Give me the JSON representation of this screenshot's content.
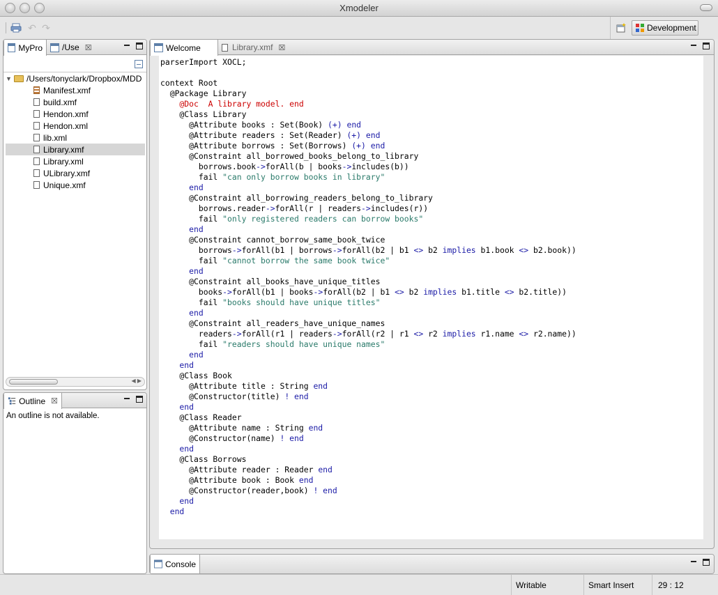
{
  "window": {
    "title": "Xmodeler"
  },
  "toolbar": {
    "print_icon": "print-icon",
    "back_icon": "back-arrow-icon",
    "forward_icon": "forward-arrow-icon",
    "perspective_label": "Development"
  },
  "explorer": {
    "tabs": [
      {
        "label": "MyPro",
        "icon": "package-explorer-icon"
      },
      {
        "label": "/Use",
        "icon": "navigator-icon",
        "closable": true
      }
    ],
    "tree": {
      "root": "/Users/tonyclark/Dropbox/MDD",
      "items": [
        {
          "label": "Manifest.xmf",
          "icon": "manifest-icon",
          "selected": false
        },
        {
          "label": "build.xmf",
          "icon": "file-icon",
          "selected": false
        },
        {
          "label": "Hendon.xmf",
          "icon": "file-icon",
          "selected": false
        },
        {
          "label": "Hendon.xml",
          "icon": "file-icon",
          "selected": false
        },
        {
          "label": "lib.xml",
          "icon": "file-icon",
          "selected": false
        },
        {
          "label": "Library.xmf",
          "icon": "file-icon",
          "selected": true
        },
        {
          "label": "Library.xml",
          "icon": "file-icon",
          "selected": false
        },
        {
          "label": "ULibrary.xmf",
          "icon": "file-icon",
          "selected": false
        },
        {
          "label": "Unique.xmf",
          "icon": "file-icon",
          "selected": false
        }
      ]
    }
  },
  "outline": {
    "tab_label": "Outline",
    "message": "An outline is not available."
  },
  "editor": {
    "tabs": [
      {
        "label": "Welcome",
        "active": true
      },
      {
        "label": "Library.xmf",
        "active": false,
        "closable": true
      }
    ],
    "lines": [
      [
        [
          "p",
          "parserImport XOCL;"
        ]
      ],
      [
        [
          "p",
          ""
        ]
      ],
      [
        [
          "p",
          "context Root"
        ]
      ],
      [
        [
          "p",
          "  @Package Library"
        ]
      ],
      [
        [
          "d",
          "    @Doc  A library model. end"
        ]
      ],
      [
        [
          "p",
          "    @Class Library"
        ]
      ],
      [
        [
          "p",
          "      @Attribute books : Set(Book) "
        ],
        [
          "k",
          "(+) end"
        ]
      ],
      [
        [
          "p",
          "      @Attribute readers : Set(Reader) "
        ],
        [
          "k",
          "(+) end"
        ]
      ],
      [
        [
          "p",
          "      @Attribute borrows : Set(Borrows) "
        ],
        [
          "k",
          "(+) end"
        ]
      ],
      [
        [
          "p",
          "      @Constraint all_borrowed_books_belong_to_library"
        ]
      ],
      [
        [
          "p",
          "        borrows.book"
        ],
        [
          "k",
          "->"
        ],
        [
          "p",
          "forAll(b | books"
        ],
        [
          "k",
          "->"
        ],
        [
          "p",
          "includes(b))"
        ]
      ],
      [
        [
          "p",
          "        fail "
        ],
        [
          "s",
          "\"can only borrow books in library\""
        ]
      ],
      [
        [
          "k",
          "      end"
        ]
      ],
      [
        [
          "p",
          "      @Constraint all_borrowing_readers_belong_to_library"
        ]
      ],
      [
        [
          "p",
          "        borrows.reader"
        ],
        [
          "k",
          "->"
        ],
        [
          "p",
          "forAll(r | readers"
        ],
        [
          "k",
          "->"
        ],
        [
          "p",
          "includes(r))"
        ]
      ],
      [
        [
          "p",
          "        fail "
        ],
        [
          "s",
          "\"only registered readers can borrow books\""
        ]
      ],
      [
        [
          "k",
          "      end"
        ]
      ],
      [
        [
          "p",
          "      @Constraint cannot_borrow_same_book_twice"
        ]
      ],
      [
        [
          "p",
          "        borrows"
        ],
        [
          "k",
          "->"
        ],
        [
          "p",
          "forAll(b1 | borrows"
        ],
        [
          "k",
          "->"
        ],
        [
          "p",
          "forAll(b2 | b1 "
        ],
        [
          "k",
          "<>"
        ],
        [
          "p",
          " b2 "
        ],
        [
          "k",
          "implies"
        ],
        [
          "p",
          " b1.book "
        ],
        [
          "k",
          "<>"
        ],
        [
          "p",
          " b2.book))"
        ]
      ],
      [
        [
          "p",
          "        fail "
        ],
        [
          "s",
          "\"cannot borrow the same book twice\""
        ]
      ],
      [
        [
          "k",
          "      end"
        ]
      ],
      [
        [
          "p",
          "      @Constraint all_books_have_unique_titles"
        ]
      ],
      [
        [
          "p",
          "        books"
        ],
        [
          "k",
          "->"
        ],
        [
          "p",
          "forAll(b1 | books"
        ],
        [
          "k",
          "->"
        ],
        [
          "p",
          "forAll(b2 | b1 "
        ],
        [
          "k",
          "<>"
        ],
        [
          "p",
          " b2 "
        ],
        [
          "k",
          "implies"
        ],
        [
          "p",
          " b1.title "
        ],
        [
          "k",
          "<>"
        ],
        [
          "p",
          " b2.title))"
        ]
      ],
      [
        [
          "p",
          "        fail "
        ],
        [
          "s",
          "\"books should have unique titles\""
        ]
      ],
      [
        [
          "k",
          "      end"
        ]
      ],
      [
        [
          "p",
          "      @Constraint all_readers_have_unique_names"
        ]
      ],
      [
        [
          "p",
          "        readers"
        ],
        [
          "k",
          "->"
        ],
        [
          "p",
          "forAll(r1 | readers"
        ],
        [
          "k",
          "->"
        ],
        [
          "p",
          "forAll(r2 | r1 "
        ],
        [
          "k",
          "<>"
        ],
        [
          "p",
          " r2 "
        ],
        [
          "k",
          "implies"
        ],
        [
          "p",
          " r1.name "
        ],
        [
          "k",
          "<>"
        ],
        [
          "p",
          " r2.name))"
        ]
      ],
      [
        [
          "p",
          "        fail "
        ],
        [
          "s",
          "\"readers should have unique names\""
        ]
      ],
      [
        [
          "k",
          "      end"
        ]
      ],
      [
        [
          "k",
          "    end"
        ]
      ],
      [
        [
          "p",
          "    @Class Book"
        ]
      ],
      [
        [
          "p",
          "      @Attribute title : String "
        ],
        [
          "k",
          "end"
        ]
      ],
      [
        [
          "p",
          "      @Constructor(title) "
        ],
        [
          "k",
          "! end"
        ]
      ],
      [
        [
          "k",
          "    end"
        ]
      ],
      [
        [
          "p",
          "    @Class Reader"
        ]
      ],
      [
        [
          "p",
          "      @Attribute name : String "
        ],
        [
          "k",
          "end"
        ]
      ],
      [
        [
          "p",
          "      @Constructor(name) "
        ],
        [
          "k",
          "! end"
        ]
      ],
      [
        [
          "k",
          "    end"
        ]
      ],
      [
        [
          "p",
          "    @Class Borrows"
        ]
      ],
      [
        [
          "p",
          "      @Attribute reader : Reader "
        ],
        [
          "k",
          "end"
        ]
      ],
      [
        [
          "p",
          "      @Attribute book : Book "
        ],
        [
          "k",
          "end"
        ]
      ],
      [
        [
          "p",
          "      @Constructor(reader,book) "
        ],
        [
          "k",
          "! end"
        ]
      ],
      [
        [
          "k",
          "    end"
        ]
      ],
      [
        [
          "k",
          "  end"
        ]
      ]
    ]
  },
  "console": {
    "tab_label": "Console"
  },
  "status": {
    "mode": "Writable",
    "insert": "Smart Insert",
    "position": "29 : 12"
  }
}
